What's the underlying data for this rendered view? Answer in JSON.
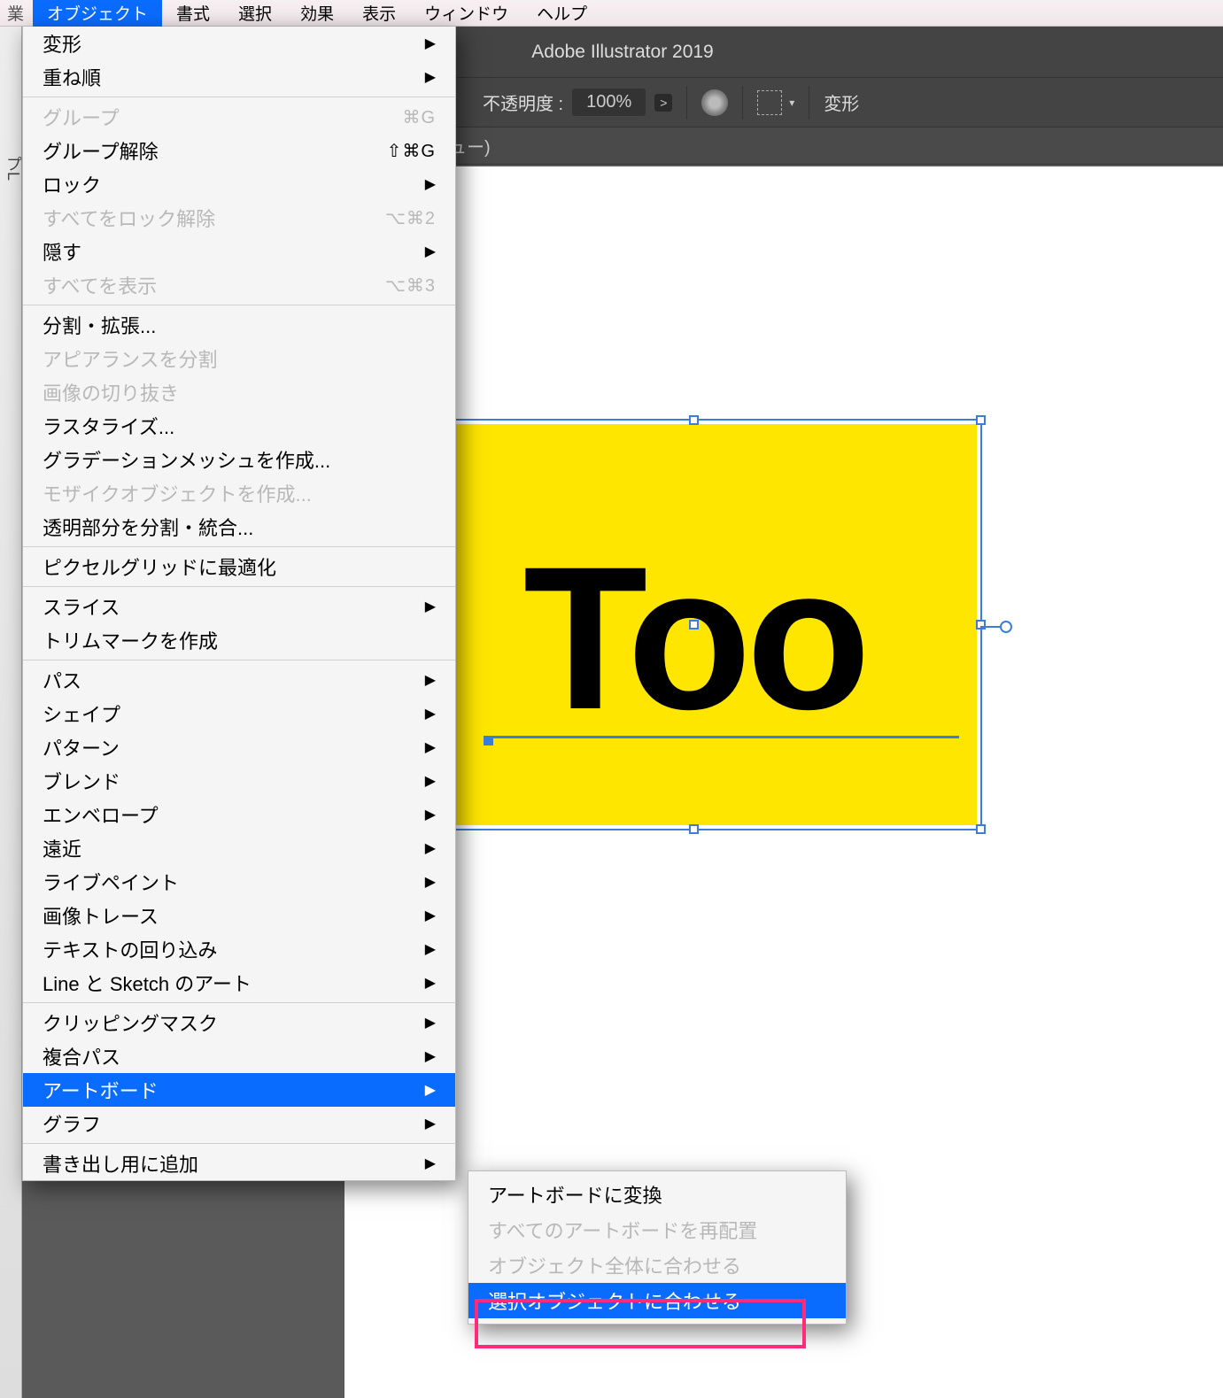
{
  "menubar": {
    "truncated": "業",
    "items": [
      "オブジェクト",
      "書式",
      "選択",
      "効果",
      "表示",
      "ウィンドウ",
      "ヘルプ"
    ],
    "activeIndex": 0
  },
  "appTitle": "Adobe Illustrator 2019",
  "toolbar": {
    "opacityLabel": "不透明度 :",
    "opacityValue": "100%",
    "transformLabel": "変形"
  },
  "docbar": "ュー)",
  "leftEdge": {
    "tabText": "プL"
  },
  "artwork": {
    "text": "Too"
  },
  "menu": [
    {
      "t": "item",
      "label": "変形",
      "arrow": true
    },
    {
      "t": "item",
      "label": "重ね順",
      "arrow": true
    },
    {
      "t": "sep"
    },
    {
      "t": "item",
      "label": "グループ",
      "shortcut": "⌘G",
      "disabled": true
    },
    {
      "t": "item",
      "label": "グループ解除",
      "shortcut": "⇧⌘G"
    },
    {
      "t": "item",
      "label": "ロック",
      "arrow": true
    },
    {
      "t": "item",
      "label": "すべてをロック解除",
      "shortcut": "⌥⌘2",
      "disabled": true
    },
    {
      "t": "item",
      "label": "隠す",
      "arrow": true
    },
    {
      "t": "item",
      "label": "すべてを表示",
      "shortcut": "⌥⌘3",
      "disabled": true
    },
    {
      "t": "sep"
    },
    {
      "t": "item",
      "label": "分割・拡張..."
    },
    {
      "t": "item",
      "label": "アピアランスを分割",
      "disabled": true
    },
    {
      "t": "item",
      "label": "画像の切り抜き",
      "disabled": true
    },
    {
      "t": "item",
      "label": "ラスタライズ..."
    },
    {
      "t": "item",
      "label": "グラデーションメッシュを作成..."
    },
    {
      "t": "item",
      "label": "モザイクオブジェクトを作成...",
      "disabled": true
    },
    {
      "t": "item",
      "label": "透明部分を分割・統合..."
    },
    {
      "t": "sep"
    },
    {
      "t": "item",
      "label": "ピクセルグリッドに最適化"
    },
    {
      "t": "sep"
    },
    {
      "t": "item",
      "label": "スライス",
      "arrow": true
    },
    {
      "t": "item",
      "label": "トリムマークを作成"
    },
    {
      "t": "sep"
    },
    {
      "t": "item",
      "label": "パス",
      "arrow": true
    },
    {
      "t": "item",
      "label": "シェイプ",
      "arrow": true
    },
    {
      "t": "item",
      "label": "パターン",
      "arrow": true
    },
    {
      "t": "item",
      "label": "ブレンド",
      "arrow": true
    },
    {
      "t": "item",
      "label": "エンベロープ",
      "arrow": true
    },
    {
      "t": "item",
      "label": "遠近",
      "arrow": true
    },
    {
      "t": "item",
      "label": "ライブペイント",
      "arrow": true
    },
    {
      "t": "item",
      "label": "画像トレース",
      "arrow": true
    },
    {
      "t": "item",
      "label": "テキストの回り込み",
      "arrow": true
    },
    {
      "t": "item",
      "label": "Line と Sketch のアート",
      "arrow": true
    },
    {
      "t": "sep"
    },
    {
      "t": "item",
      "label": "クリッピングマスク",
      "arrow": true
    },
    {
      "t": "item",
      "label": "複合パス",
      "arrow": true
    },
    {
      "t": "item",
      "label": "アートボード",
      "arrow": true,
      "active": true
    },
    {
      "t": "item",
      "label": "グラフ",
      "arrow": true
    },
    {
      "t": "sep"
    },
    {
      "t": "item",
      "label": "書き出し用に追加",
      "arrow": true
    }
  ],
  "submenu": [
    {
      "label": "アートボードに変換"
    },
    {
      "t": "sep"
    },
    {
      "label": "すべてのアートボードを再配置",
      "disabled": true
    },
    {
      "t": "sep"
    },
    {
      "label": "オブジェクト全体に合わせる",
      "disabled": true
    },
    {
      "label": "選択オブジェクトに合わせる",
      "active": true
    }
  ]
}
